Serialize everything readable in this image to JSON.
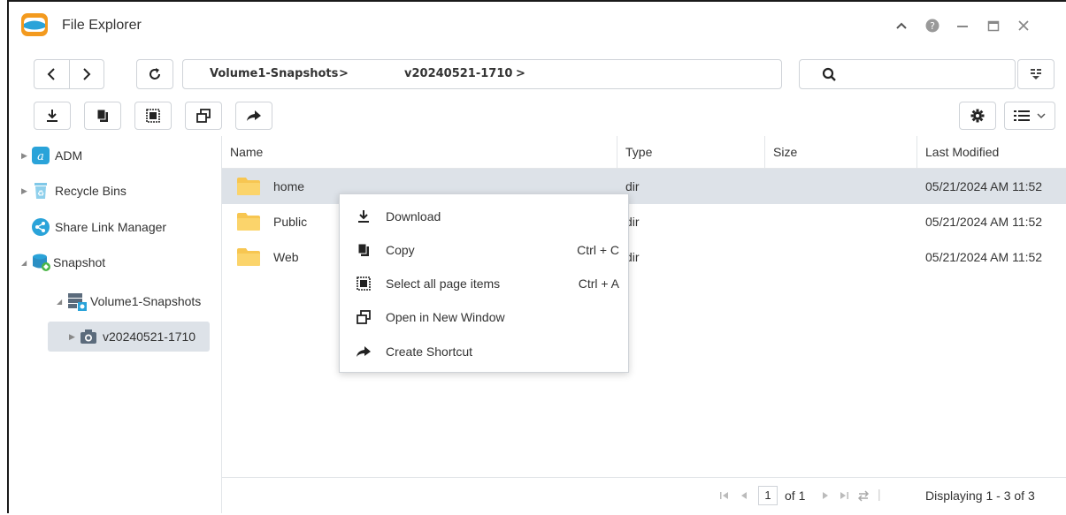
{
  "window": {
    "title": "File Explorer"
  },
  "nav": {
    "breadcrumb": [
      "Volume1-Snapshots",
      "v20240521-1710"
    ],
    "search_placeholder": ""
  },
  "sidebar": {
    "items": [
      {
        "label": "ADM",
        "icon": "adm-icon"
      },
      {
        "label": "Recycle Bins",
        "icon": "recycle-bin-icon"
      },
      {
        "label": "Share Link Manager",
        "icon": "share-link-icon"
      },
      {
        "label": "Snapshot",
        "icon": "snapshot-db-icon"
      },
      {
        "label": "Volume1-Snapshots",
        "icon": "volume-snapshots-icon"
      },
      {
        "label": "v20240521-1710",
        "icon": "camera-icon"
      }
    ]
  },
  "table": {
    "columns": [
      "Name",
      "Type",
      "Size",
      "Last Modified"
    ],
    "rows": [
      {
        "name": "home",
        "type": "dir",
        "size": "",
        "modified": "05/21/2024 AM 11:52"
      },
      {
        "name": "Public",
        "type": "dir",
        "size": "",
        "modified": "05/21/2024 AM 11:52"
      },
      {
        "name": "Web",
        "type": "dir",
        "size": "",
        "modified": "05/21/2024 AM 11:52"
      }
    ]
  },
  "context_menu": {
    "items": [
      {
        "label": "Download",
        "shortcut": "",
        "icon": "download-icon"
      },
      {
        "label": "Copy",
        "shortcut": "Ctrl + C",
        "icon": "copy-icon"
      },
      {
        "label": "Select all page items",
        "shortcut": "Ctrl + A",
        "icon": "select-all-icon"
      },
      {
        "label": "Open in New Window",
        "shortcut": "",
        "icon": "new-window-icon"
      },
      {
        "label": "Create Shortcut",
        "shortcut": "",
        "icon": "shortcut-arrow-icon"
      }
    ]
  },
  "pager": {
    "page": "1",
    "of_label": "of 1",
    "display_text": "Displaying 1 - 3 of 3"
  },
  "colors": {
    "folder": "#f7c651",
    "selection": "#dde2e8",
    "accent": "#2aa3d9"
  }
}
